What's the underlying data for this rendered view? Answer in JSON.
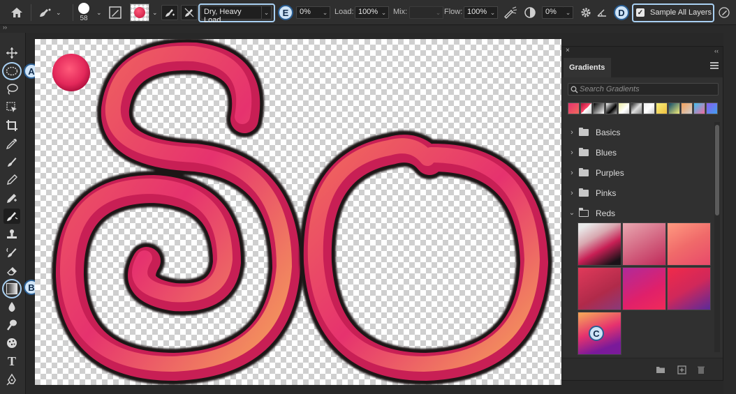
{
  "options_bar": {
    "brush_size": "58",
    "mixer_preset": "Dry, Heavy Load",
    "wet": "0%",
    "load_label": "Load:",
    "load": "100%",
    "mix_label": "Mix:",
    "mix": "",
    "flow_label": "Flow:",
    "flow": "100%",
    "smoothing": "0%",
    "sample_all_layers_label": "Sample All Layers",
    "sample_all_layers_checked": true
  },
  "callouts": {
    "a": "A",
    "b": "B",
    "c": "C",
    "d": "D",
    "e": "E"
  },
  "tabs_row": {
    "collapse_glyph": "››"
  },
  "toolbar": {
    "tools": [
      "move-tool",
      "elliptical-marquee-tool",
      "lasso-tool",
      "object-selection-tool",
      "crop-tool",
      "eyedropper-tool",
      "healing-brush-tool",
      "brush-tool",
      "clone-tool",
      "mixer-brush-tool",
      "stamp-tool",
      "history-brush-tool",
      "eraser-tool",
      "gradient-tool",
      "blur-tool",
      "dodge-tool",
      "sponge-tool",
      "type-tool",
      "pen-tool"
    ]
  },
  "panel": {
    "close_glyph": "×",
    "collapse_glyph": "‹‹",
    "tab_title": "Gradients",
    "search_placeholder": "Search Gradients",
    "folders": [
      {
        "name": "Basics",
        "open": false
      },
      {
        "name": "Blues",
        "open": false
      },
      {
        "name": "Purples",
        "open": false
      },
      {
        "name": "Pinks",
        "open": false
      },
      {
        "name": "Reds",
        "open": true
      }
    ]
  },
  "colors": {
    "accent_highlight": "#a9d0f2",
    "callout_fill": "#cfe4f7",
    "stroke_pink": "#e6326e",
    "stroke_orange": "#f5a05a",
    "stroke_dark": "#1a1218"
  }
}
